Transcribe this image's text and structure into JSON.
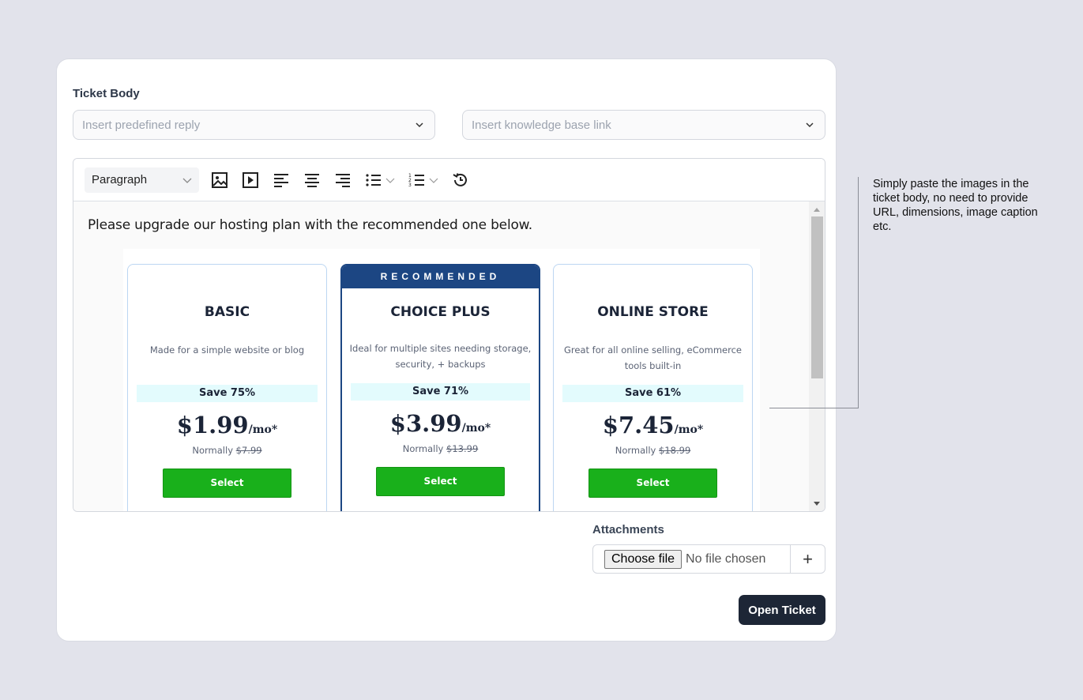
{
  "form": {
    "ticket_body_label": "Ticket Body",
    "predefined_reply": {
      "placeholder": "Insert predefined reply",
      "icon": "chevron-down-icon"
    },
    "knowledge_base": {
      "placeholder": "Insert knowledge base link",
      "icon": "chevron-down-icon"
    }
  },
  "toolbar": {
    "block_format": "Paragraph",
    "buttons": [
      "image-icon",
      "media-icon",
      "align-left-icon",
      "align-center-icon",
      "align-right-icon",
      "bullet-list-icon",
      "numbered-list-icon",
      "history-icon"
    ]
  },
  "editor": {
    "paragraph": "Please upgrade our hosting plan with the recommended one below.",
    "pasted_image": {
      "recommended_label": "RECOMMENDED",
      "plans": [
        {
          "name": "BASIC",
          "description": "Made for a simple website or blog",
          "save": "Save 75%",
          "price": "$1.99",
          "per": "/mo*",
          "normally_label": "Normally",
          "normally_price": "$7.99",
          "button": "Select",
          "recommended": false
        },
        {
          "name": "CHOICE PLUS",
          "description": "Ideal for multiple sites needing storage, security, + backups",
          "save": "Save 71%",
          "price": "$3.99",
          "per": "/mo*",
          "normally_label": "Normally",
          "normally_price": "$13.99",
          "button": "Select",
          "recommended": true
        },
        {
          "name": "ONLINE STORE",
          "description": "Great for all online selling, eCommerce tools built-in",
          "save": "Save 61%",
          "price": "$7.45",
          "per": "/mo*",
          "normally_label": "Normally",
          "normally_price": "$18.99",
          "button": "Select",
          "recommended": false
        }
      ]
    }
  },
  "attachments": {
    "label": "Attachments",
    "choose_file": "Choose file",
    "no_file": "No file chosen",
    "add": "+"
  },
  "submit": {
    "label": "Open Ticket"
  },
  "callout": {
    "text": "Simply paste the images in the ticket body, no need to provide URL, dimensions, image caption etc."
  },
  "colors": {
    "accent_dark": "#1d2636",
    "recommended_blue": "#1c4683",
    "select_green": "#19b01b",
    "save_band": "#e3fbfd"
  }
}
